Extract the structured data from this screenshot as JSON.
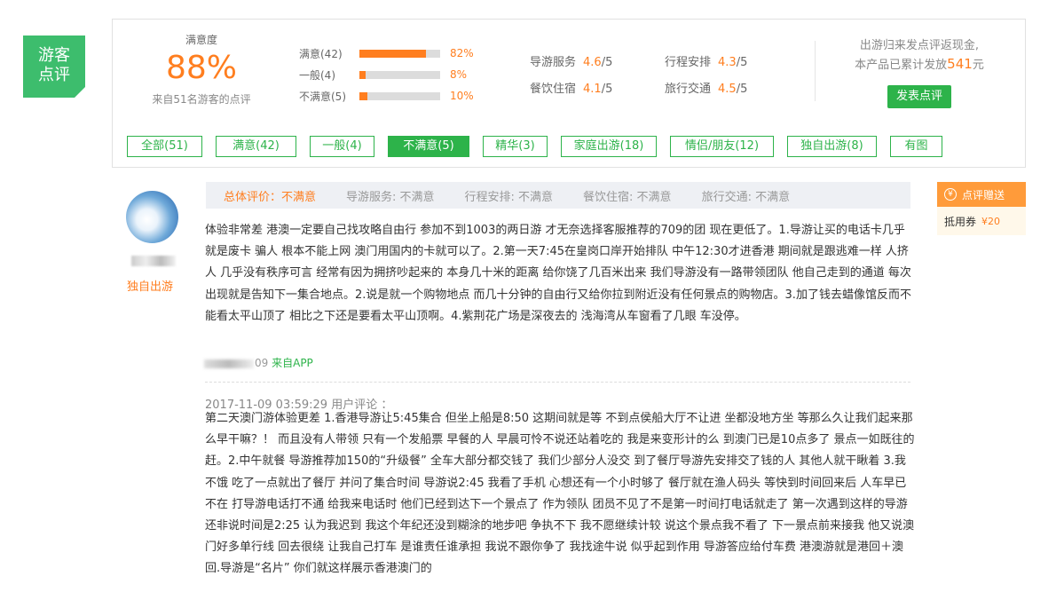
{
  "badge": {
    "line1": "游客",
    "line2": "点评"
  },
  "summary": {
    "satisfaction_label": "满意度",
    "satisfaction_pct": "88%",
    "source_text": "来自51名游客的点评",
    "bars": [
      {
        "name": "满意(42)",
        "pct": "82%",
        "fraction": 0.82
      },
      {
        "name": "一般(4)",
        "pct": "8%",
        "fraction": 0.08
      },
      {
        "name": "不满意(5)",
        "pct": "10%",
        "fraction": 0.1
      }
    ],
    "ratings": [
      {
        "name": "导游服务",
        "value": "4.6",
        "denom": "/5"
      },
      {
        "name": "行程安排",
        "value": "4.3",
        "denom": "/5"
      },
      {
        "name": "餐饮住宿",
        "value": "4.1",
        "denom": "/5"
      },
      {
        "name": "旅行交通",
        "value": "4.5",
        "denom": "/5"
      }
    ],
    "promo_line1": "出游归来发点评返现金,",
    "promo_line2_prefix": "本产品已累计发放",
    "promo_amount": "541",
    "promo_unit": "元",
    "post_button": "发表点评"
  },
  "filters": [
    {
      "label": "全部(51)",
      "active": false
    },
    {
      "label": "满意(42)",
      "active": false
    },
    {
      "label": "一般(4)",
      "active": false
    },
    {
      "label": "不满意(5)",
      "active": true
    },
    {
      "label": "精华(3)",
      "active": false
    },
    {
      "label": "家庭出游(18)",
      "active": false
    },
    {
      "label": "情侣/朋友(12)",
      "active": false
    },
    {
      "label": "独自出游(8)",
      "active": false
    },
    {
      "label": "有图",
      "active": false
    }
  ],
  "review": {
    "user_type": "独自出游",
    "overall": "总体评价：不满意",
    "sub_ratings": [
      "导游服务: 不满意",
      "行程安排: 不满意",
      "餐饮住宿: 不满意",
      "旅行交通: 不满意"
    ],
    "text1": "体验非常差 港澳一定要自己找攻略自由行 参加不到1003的两日游 才无奈选择客服推荐的709的团 现在更低了。1.导游让买的电话卡几乎就是废卡 骗人 根本不能上网 澳门用国内的卡就可以了。2.第一天7:45在皇岗口岸开始排队 中午12:30才进香港 期间就是跟逃难一样 人挤人 几乎没有秩序可言 经常有因为拥挤吵起来的 本身几十米的距离 给你饶了几百米出来 我们导游没有一路带领团队 他自己走到的通道 每次出现就是告知下一集合地点。2.说是就一个购物地点 而几十分钟的自由行又给你拉到附近没有任何景点的购物店。3.加了钱去蜡像馆反而不能看太平山顶了 相比之下还是要看太平山顶啊。4.紫荆花广场是深夜去的 浅海湾从车窗看了几眼 车没停。",
    "meta_date_tail": "09",
    "meta_from": "来自APP",
    "followup_meta": "2017-11-09 03:59:29 用户评论 ：",
    "text2": "第二天澳门游体验更差 1.香港导游让5:45集合 但坐上船是8:50 这期间就是等 不到点侯船大厅不让进 坐都没地方坐 等那么久让我们起来那么早干嘛？！ 而且没有人带领 只有一个发船票 早餐的人 早晨可怜不说还站着吃的 我是来变形计的么 到澳门已是10点多了 景点一如既往的赶。2.中午就餐 导游推荐加150的“升级餐” 全车大部分都交钱了 我们少部分人没交 到了餐厅导游先安排交了钱的人 其他人就干瞅着 3.我不饿 吃了一点就出了餐厅 并问了集合时间 导游说2:45 我看了手机 心想还有一个小时够了 餐厅就在渔人码头 等快到时间回来后 人车早已不在 打导游电话打不通 给我来电话时 他们已经到达下一个景点了 作为领队 团员不见了不是第一时间打电话就走了 第一次遇到这样的导游 还非说时间是2:25 认为我迟到 我这个年纪还没到糊涂的地步吧 争执不下 我不愿继续计较 说这个景点我不看了 下一景点前来接我 他又说澳门好多单行线 回去很绕 让我自己打车 是谁责任谁承担 我说不跟你争了 我找途牛说 似乎起到作用 导游答应给付车费 港澳游就是港回＋澳回.导游是“名片” 你们就这样展示香港澳门的"
  },
  "side_card": {
    "title": "点评赠送",
    "coin": "¥",
    "item": "抵用券",
    "amount": "¥20"
  },
  "colors": {
    "accent": "#ff7e1f",
    "brand_green": "#2db34a",
    "badge_green": "#3dbd6d"
  }
}
